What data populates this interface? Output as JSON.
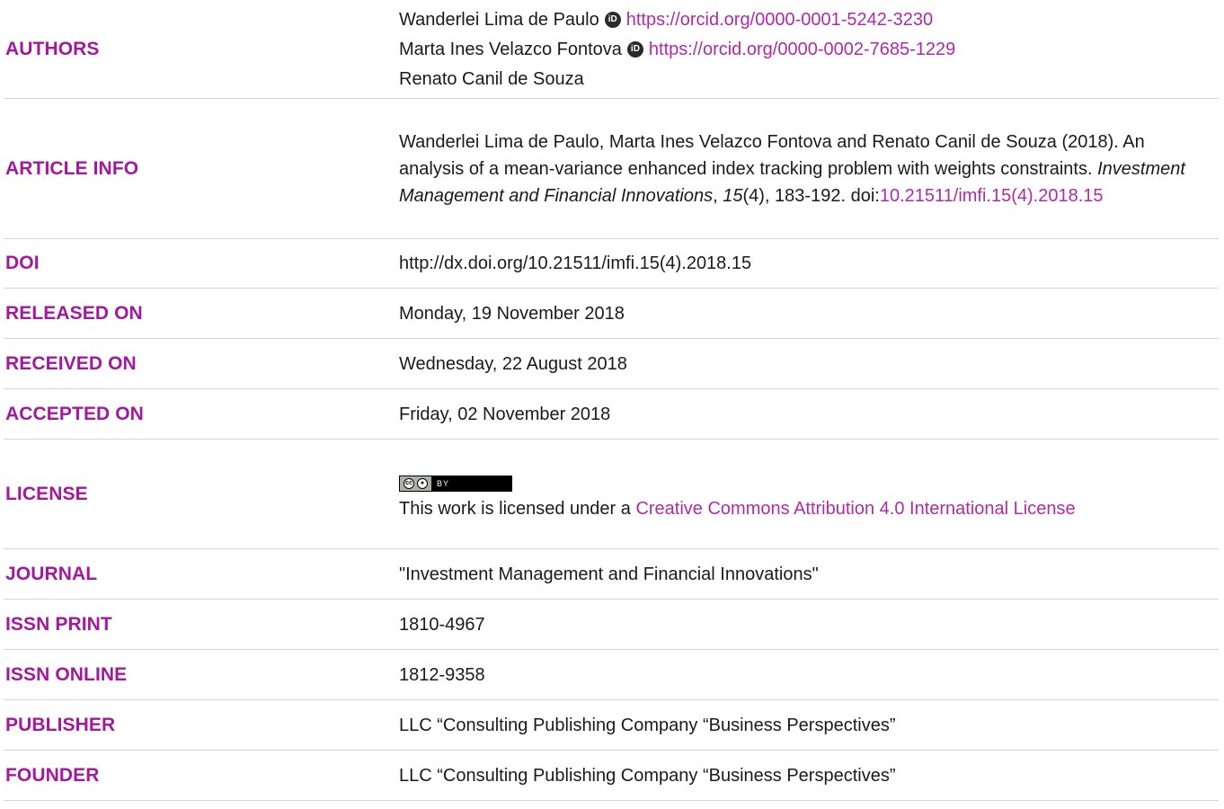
{
  "rows": {
    "authors": {
      "label": "AUTHORS",
      "list": [
        {
          "name": "Wanderlei Lima de Paulo",
          "orcid": "https://orcid.org/0000-0001-5242-3230"
        },
        {
          "name": "Marta Ines Velazco Fontova",
          "orcid": "https://orcid.org/0000-0002-7685-1229"
        },
        {
          "name": "Renato Canil de Souza"
        }
      ]
    },
    "article_info": {
      "label": "ARTICLE INFO",
      "citation_pre": "Wanderlei Lima de Paulo, Marta Ines Velazco Fontova and Renato Canil de Souza (2018). An analysis of a mean-variance enhanced index tracking problem with weights constraints. ",
      "journal_italic": "Investment Management and Financial Innovations",
      "comma": ", ",
      "volume_italic": "15",
      "issue_pages": "(4), 183-192. doi:",
      "doi_link": "10.21511/imfi.15(4).2018.15"
    },
    "doi": {
      "label": "DOI",
      "value": "http://dx.doi.org/10.21511/imfi.15(4).2018.15"
    },
    "released_on": {
      "label": "RELEASED ON",
      "value": "Monday, 19 November 2018"
    },
    "received_on": {
      "label": "RECEIVED ON",
      "value": "Wednesday, 22 August 2018"
    },
    "accepted_on": {
      "label": "ACCEPTED ON",
      "value": "Friday, 02 November 2018"
    },
    "license": {
      "label": "LICENSE",
      "badge_cc": "cc",
      "badge_by": "BY",
      "text_pre": "This work is licensed under a ",
      "text_link": "Creative Commons Attribution 4.0 International License"
    },
    "journal": {
      "label": "JOURNAL",
      "value": "\"Investment Management and Financial Innovations\""
    },
    "issn_print": {
      "label": "ISSN PRINT",
      "value": "1810-4967"
    },
    "issn_online": {
      "label": "ISSN ONLINE",
      "value": "1812-9358"
    },
    "publisher": {
      "label": "PUBLISHER",
      "value": "LLC “Consulting Publishing Company “Business Perspectives”"
    },
    "founder": {
      "label": "FOUNDER",
      "value": "LLC “Consulting Publishing Company “Business Perspectives”"
    }
  },
  "icons": {
    "orcid": "orcid-icon",
    "orcid_glyph": "iD"
  },
  "colors": {
    "label": "#a3189e",
    "link": "#b02aa8",
    "divider": "#d4d4d4"
  }
}
